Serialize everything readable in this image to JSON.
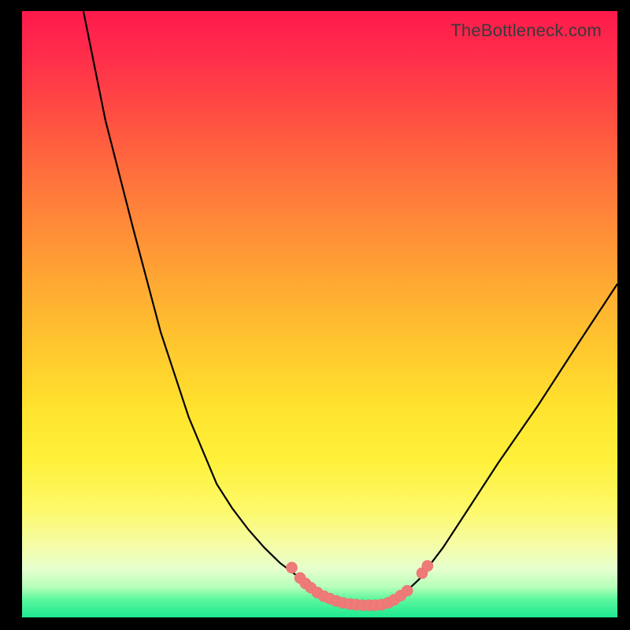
{
  "watermark": "TheBottleneck.com",
  "colors": {
    "frame": "#000000",
    "curve": "#000000",
    "marker": "#ef7b78",
    "gradient_top": "#ff1a4d",
    "gradient_bottom": "#1de890"
  },
  "chart_data": {
    "type": "line",
    "title": "",
    "xlabel": "",
    "ylabel": "",
    "xlim": [
      0,
      100
    ],
    "ylim": [
      0,
      100
    ],
    "note": "Values are estimated from pixel positions; no axes or tick labels are drawn in the image.",
    "series": [
      {
        "name": "left-curve",
        "x": [
          10.3,
          14.0,
          18.7,
          23.3,
          28.0,
          32.7,
          35.3,
          38.0,
          40.7,
          43.3,
          46.0,
          48.7,
          50.7,
          52.7,
          54.0,
          56.0,
          57.3,
          58.7
        ],
        "y": [
          100.0,
          82.0,
          64.0,
          47.0,
          33.0,
          22.0,
          18.0,
          14.5,
          11.5,
          9.0,
          7.0,
          5.3,
          4.0,
          3.0,
          2.5,
          2.0,
          2.0,
          2.0
        ]
      },
      {
        "name": "right-curve",
        "x": [
          58.7,
          60.0,
          61.3,
          62.7,
          64.0,
          65.3,
          66.7,
          68.0,
          70.7,
          74.7,
          80.0,
          86.7,
          93.3,
          100.0
        ],
        "y": [
          2.0,
          2.0,
          2.3,
          3.0,
          4.0,
          5.0,
          6.3,
          8.0,
          11.5,
          17.5,
          25.5,
          35.0,
          45.0,
          55.0
        ]
      }
    ],
    "markers": [
      {
        "name": "basin-marker",
        "x": 45.3,
        "y": 8.2
      },
      {
        "name": "basin-marker",
        "x": 46.7,
        "y": 6.5
      },
      {
        "name": "basin-marker",
        "x": 47.6,
        "y": 5.6
      },
      {
        "name": "basin-marker",
        "x": 48.5,
        "y": 4.9
      },
      {
        "name": "basin-marker",
        "x": 49.6,
        "y": 4.1
      },
      {
        "name": "basin-marker",
        "x": 50.7,
        "y": 3.5
      },
      {
        "name": "basin-marker",
        "x": 51.7,
        "y": 3.1
      },
      {
        "name": "basin-marker",
        "x": 52.8,
        "y": 2.7
      },
      {
        "name": "basin-marker",
        "x": 53.9,
        "y": 2.4
      },
      {
        "name": "basin-marker",
        "x": 55.1,
        "y": 2.2
      },
      {
        "name": "basin-marker",
        "x": 56.1,
        "y": 2.1
      },
      {
        "name": "basin-marker",
        "x": 57.2,
        "y": 2.0
      },
      {
        "name": "basin-marker",
        "x": 58.3,
        "y": 2.0
      },
      {
        "name": "basin-marker",
        "x": 59.3,
        "y": 2.0
      },
      {
        "name": "basin-marker",
        "x": 60.4,
        "y": 2.1
      },
      {
        "name": "basin-marker",
        "x": 61.5,
        "y": 2.4
      },
      {
        "name": "basin-marker",
        "x": 62.5,
        "y": 2.9
      },
      {
        "name": "basin-marker",
        "x": 63.6,
        "y": 3.6
      },
      {
        "name": "basin-marker",
        "x": 64.7,
        "y": 4.4
      },
      {
        "name": "basin-marker",
        "x": 67.2,
        "y": 7.3
      },
      {
        "name": "basin-marker",
        "x": 68.1,
        "y": 8.5
      }
    ]
  }
}
